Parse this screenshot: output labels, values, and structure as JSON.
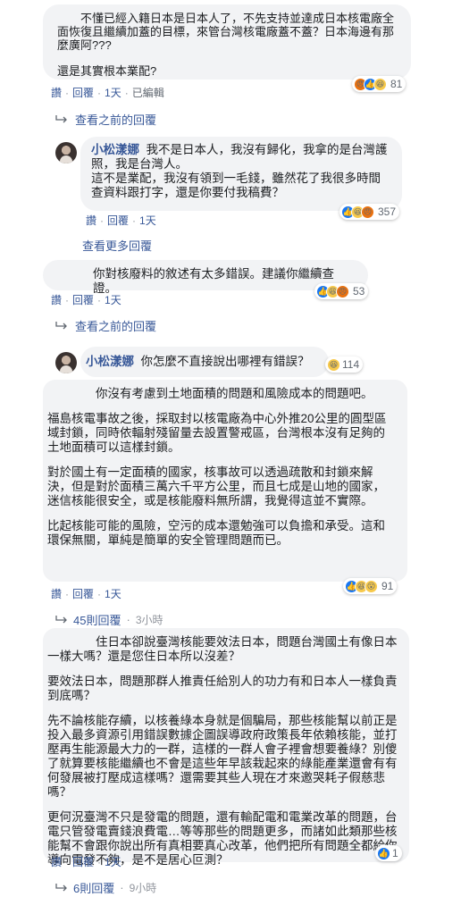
{
  "comments": {
    "c1": {
      "lines": [
        "　　不懂已經入籍日本是日本人了，不先支持並達成日本核電廠全面恢復且繼續加蓋的目標，來管台灣核電廠蓋不蓋？日本海邊有那麼廣阿???",
        "還是其實根本業配?"
      ],
      "like": "讚",
      "reply": "回覆",
      "time": "1天",
      "edited": "已編輯",
      "react_count": "81",
      "view_prev": "查看之前的回覆"
    },
    "c2": {
      "author": "小松漾娜",
      "lines": [
        "我不是日本人，我沒有歸化，我拿的是台灣護照，我是台灣人。",
        "這不是業配，我沒有領到一毛錢，雖然花了我很多時間查資料跟打字，還是你要付我稿費？"
      ],
      "like": "讚",
      "reply": "回覆",
      "time": "1天",
      "react_count": "357",
      "view_more": "查看更多回覆"
    },
    "c3": {
      "text": "你對核廢料的敘述有太多錯誤。建議你繼續查證。",
      "like": "讚",
      "reply": "回覆",
      "time": "1天",
      "react_count": "53",
      "view_prev": "查看之前的回覆"
    },
    "c4": {
      "author": "小松漾娜",
      "text": "你怎麼不直接說出哪裡有錯誤？",
      "react_count": "114"
    },
    "c5": {
      "lines": [
        "　　　　你沒有考慮到土地面積的問題和風險成本的問題吧。",
        "福島核電事故之後，採取封以核電廠為中心外推20公里的圓型區域封鎖，同時依輻射殘留量去設置警戒區，台灣根本沒有足夠的土地面積可以這樣封鎖。",
        "對於國土有一定面積的國家，核事故可以透過疏散和封鎖來解決，但是對於面積三萬六千平方公里，而且七成是山地的國家，迷信核能很安全，或是核能廢料無所謂，我覺得這並不實際。",
        "比起核能可能的風險，空污的成本還勉強可以負擔和承受。這和環保無關，單純是簡單的安全管理問題而已。"
      ],
      "like": "讚",
      "reply": "回覆",
      "time": "1天",
      "react_count": "91",
      "replies_link": "45則回覆",
      "replies_time": "3小時"
    },
    "c6": {
      "lines": [
        "　　　　住日本卻說臺灣核能要效法日本，問題台灣國土有像日本一樣大嗎？還是您住日本所以沒差？",
        "要效法日本，問題那群人推責任給別人的功力有和日本人一樣負責到底嗎？",
        "先不論核能存續，以核養綠本身就是個騙局，那些核能幫以前正是投入最多資源引用錯誤數據企圖誤導政府政策長年依賴核能，並打壓再生能源最大力的一群，這樣的一群人會子裡會想要養綠？別傻了就算要核能繼續也不會是這些年早該栽起來的綠能產業還會有有何發展被打壓成這樣嗎？還需要其些人現在才來邀哭耗子假慈悲嗎？",
        "更何況臺灣不只是發電的問題，還有輸配電和電業改革的問題，台電只管發電賣錢浪費電…等等那些的問題更多，而諸如此類那些核能幫不會跟你說出所有真相要真心改革，他們把所有問題全都給你導向電發不夠，是不是居心叵測？"
      ],
      "like": "讚",
      "reply": "回覆",
      "time": "1天",
      "react_count": "1",
      "replies_link": "6則回覆",
      "replies_time": "9小時"
    }
  },
  "colors": {
    "link": "#385898",
    "bubble": "#f2f3f5",
    "meta": "#606770",
    "like_blue": "#1877f2"
  }
}
